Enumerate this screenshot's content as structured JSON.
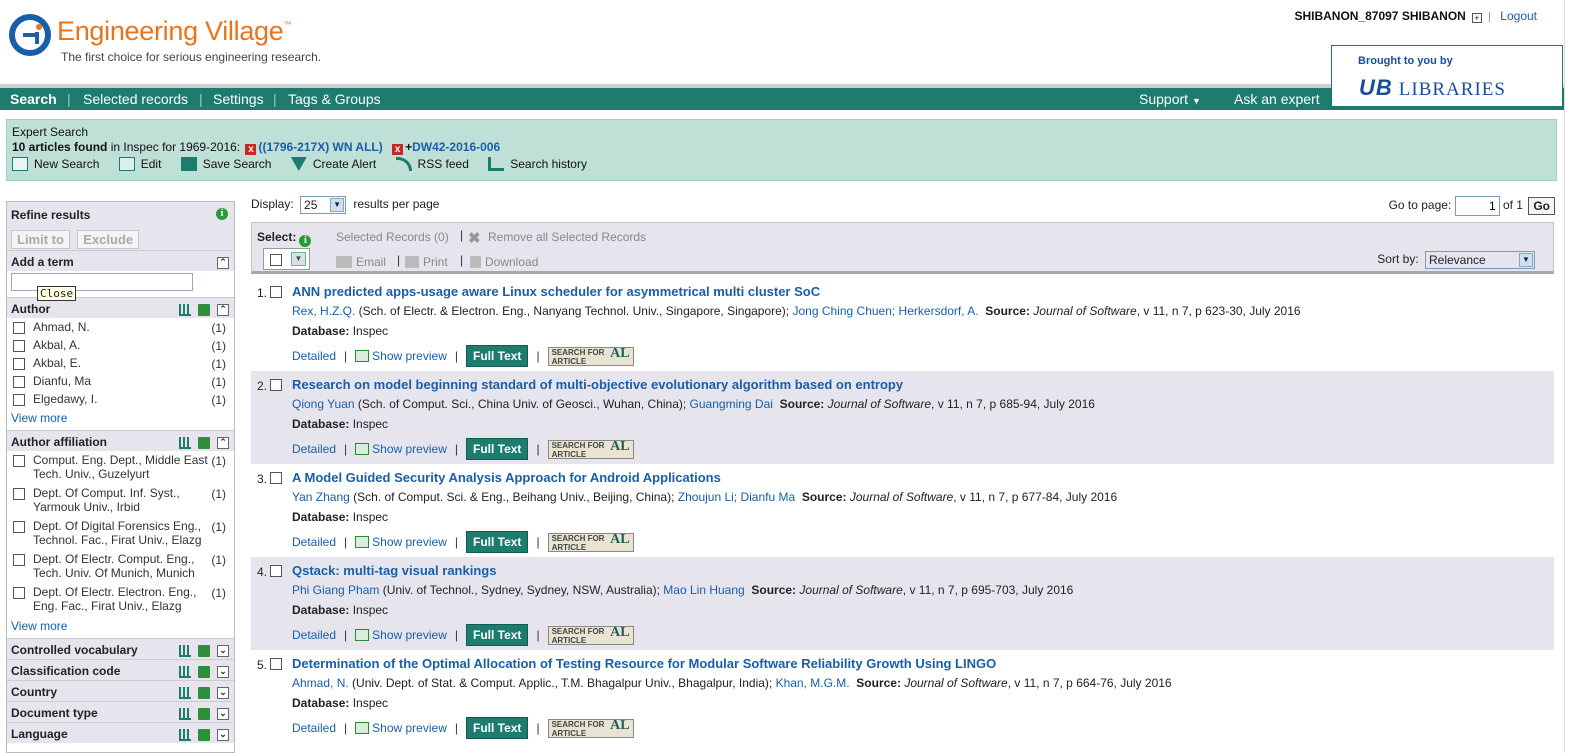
{
  "header": {
    "logo_text": "Engineering Village",
    "tm": "™",
    "tagline": "The first choice for serious engineering research.",
    "user": "SHIBANON_87097 SHIBANON",
    "logout": "Logout",
    "brought_by": "Brought to you by",
    "library": "LIBRARIES",
    "library_mark": "UB"
  },
  "nav": {
    "search": "Search",
    "selected": "Selected records",
    "settings": "Settings",
    "tags": "Tags & Groups",
    "support": "Support",
    "expert": "Ask an expert"
  },
  "search_summary": {
    "type": "Expert Search",
    "count": "10 articles found",
    "db_text": " in Inspec for 1969-2016:",
    "term1": "((1796-217X) WN ALL)",
    "term2": "DW42-2016-006",
    "actions": [
      "New Search",
      "Edit",
      "Save Search",
      "Create Alert",
      "RSS feed",
      "Search history"
    ]
  },
  "refine": {
    "title": "Refine results",
    "limit": "Limit to",
    "exclude": "Exclude",
    "add_term": "Add a term",
    "close_tip": "Close",
    "author": {
      "title": "Author",
      "items": [
        {
          "name": "Ahmad, N.",
          "count": "(1)"
        },
        {
          "name": "Akbal, A.",
          "count": "(1)"
        },
        {
          "name": "Akbal, E.",
          "count": "(1)"
        },
        {
          "name": "Dianfu, Ma",
          "count": "(1)"
        },
        {
          "name": "Elgedawy, I.",
          "count": "(1)"
        }
      ],
      "more": "View more"
    },
    "affiliation": {
      "title": "Author affiliation",
      "items": [
        {
          "l1": "Comput. Eng. Dept., Middle East",
          "l2": "Tech. Univ., Guzelyurt",
          "count": "(1)"
        },
        {
          "l1": "Dept. Of Comput. Inf. Syst.,",
          "l2": "Yarmouk Univ., Irbid",
          "count": "(1)"
        },
        {
          "l1": "Dept. Of Digital Forensics Eng.,",
          "l2": "Technol. Fac., Firat Univ., Elazg",
          "count": "(1)"
        },
        {
          "l1": "Dept. Of Electr. Comput. Eng.,",
          "l2": "Tech. Univ. Of Munich, Munich",
          "count": "(1)"
        },
        {
          "l1": "Dept. Of Electr. Electron. Eng.,",
          "l2": "Eng. Fac., Firat Univ., Elazg",
          "count": "(1)"
        }
      ],
      "more": "View more"
    },
    "collapsed": [
      "Controlled vocabulary",
      "Classification code",
      "Country",
      "Document type",
      "Language"
    ]
  },
  "display": {
    "label": "Display:",
    "value": "25",
    "suffix": "results per page",
    "goto": "Go to page:",
    "page": "1",
    "of": "of 1",
    "go": "Go"
  },
  "toolbar": {
    "select": "Select:",
    "selected": "Selected Records (0)",
    "remove": "Remove all Selected Records",
    "email": "Email",
    "print": "Print",
    "download": "Download",
    "sort_label": "Sort by:",
    "sort_value": "Relevance"
  },
  "result_labels": {
    "database": "Database:",
    "db_value": " Inspec",
    "source": "Source:",
    "detailed": "Detailed",
    "preview": "Show preview",
    "fulltext": "Full Text",
    "sfa1": "SEARCH FOR",
    "sfa2": "ARTICLE",
    "sfa_al": "AL"
  },
  "results": [
    {
      "num": "1.",
      "title": "ANN predicted apps-usage aware Linux scheduler for asymmetrical multi cluster SoC",
      "a1": "Rex, H.Z.Q.",
      "aff": " (Sch. of Electr. & Electron. Eng., Nanyang Technol. Univ., Singapore, Singapore); ",
      "a2": "Jong Ching Chuen; Herkersdorf, A.",
      "journal": "Journal of Software",
      "cite": ", v 11, n 7, p 623-30, July 2016"
    },
    {
      "num": "2.",
      "title": "Research on model beginning standard of multi-objective evolutionary algorithm based on entropy",
      "a1": "Qiong Yuan",
      "aff": " (Sch. of Comput. Sci., China Univ. of Geosci., Wuhan, China); ",
      "a2": "Guangming Dai",
      "journal": "Journal of Software",
      "cite": ", v 11, n 7, p 685-94, July 2016"
    },
    {
      "num": "3.",
      "title": "A Model Guided Security Analysis Approach for Android Applications",
      "a1": "Yan Zhang",
      "aff": " (Sch. of Comput. Sci. & Eng., Beihang Univ., Beijing, China); ",
      "a2": "Zhoujun Li; Dianfu Ma",
      "journal": "Journal of Software",
      "cite": ", v 11, n 7, p 677-84, July 2016"
    },
    {
      "num": "4.",
      "title": "Qstack: multi-tag visual rankings",
      "a1": "Phi Giang Pham",
      "aff": " (Univ. of Technol., Sydney, Sydney, NSW, Australia); ",
      "a2": "Mao Lin Huang",
      "journal": "Journal of Software",
      "cite": ", v 11, n 7, p 695-703, July 2016"
    },
    {
      "num": "5.",
      "title": "Determination of the Optimal Allocation of Testing Resource for Modular Software Reliability Growth Using LINGO",
      "a1": "Ahmad, N.",
      "aff": " (Univ. Dept. of Stat. & Comput. Applic., T.M. Bhagalpur Univ., Bhagalpur, India); ",
      "a2": "Khan, M.G.M.",
      "journal": "Journal of Software",
      "cite": ", v 11, n 7, p 664-76, July 2016"
    }
  ]
}
